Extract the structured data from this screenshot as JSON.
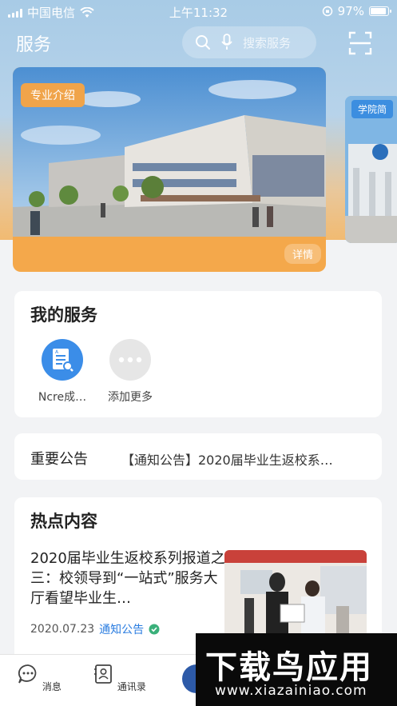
{
  "status_bar": {
    "carrier": "中国电信",
    "time": "上午11:32",
    "battery": "97%",
    "battery_level": 0.97
  },
  "header": {
    "title": "服务",
    "search_placeholder": "搜索服务"
  },
  "banner": {
    "tag": "专业介绍",
    "detail": "详情",
    "next_tag": "学院简"
  },
  "services": {
    "title": "我的服务",
    "items": [
      {
        "label": "Ncre成…",
        "icon": "document-icon",
        "color": "#3b8de8"
      },
      {
        "label": "添加更多",
        "icon": "more-icon",
        "color": "#e6e6e6"
      }
    ]
  },
  "notice": {
    "label": "重要公告",
    "text": "【通知公告】2020届毕业生返校系…"
  },
  "hot": {
    "title": "热点内容",
    "article": {
      "title": "2020届毕业生返校系列报道之三：校领导到“一站式”服务大厅看望毕业生…",
      "date": "2020.07.23",
      "category": "通知公告"
    }
  },
  "tabbar": {
    "items": [
      {
        "label": "消息"
      },
      {
        "label": "通讯录"
      }
    ]
  },
  "watermark": {
    "brand": "下载鸟应用",
    "url": "www.xiazainiao.com"
  },
  "colors": {
    "accent": "#2b7de0",
    "orange": "#f4a84b"
  }
}
